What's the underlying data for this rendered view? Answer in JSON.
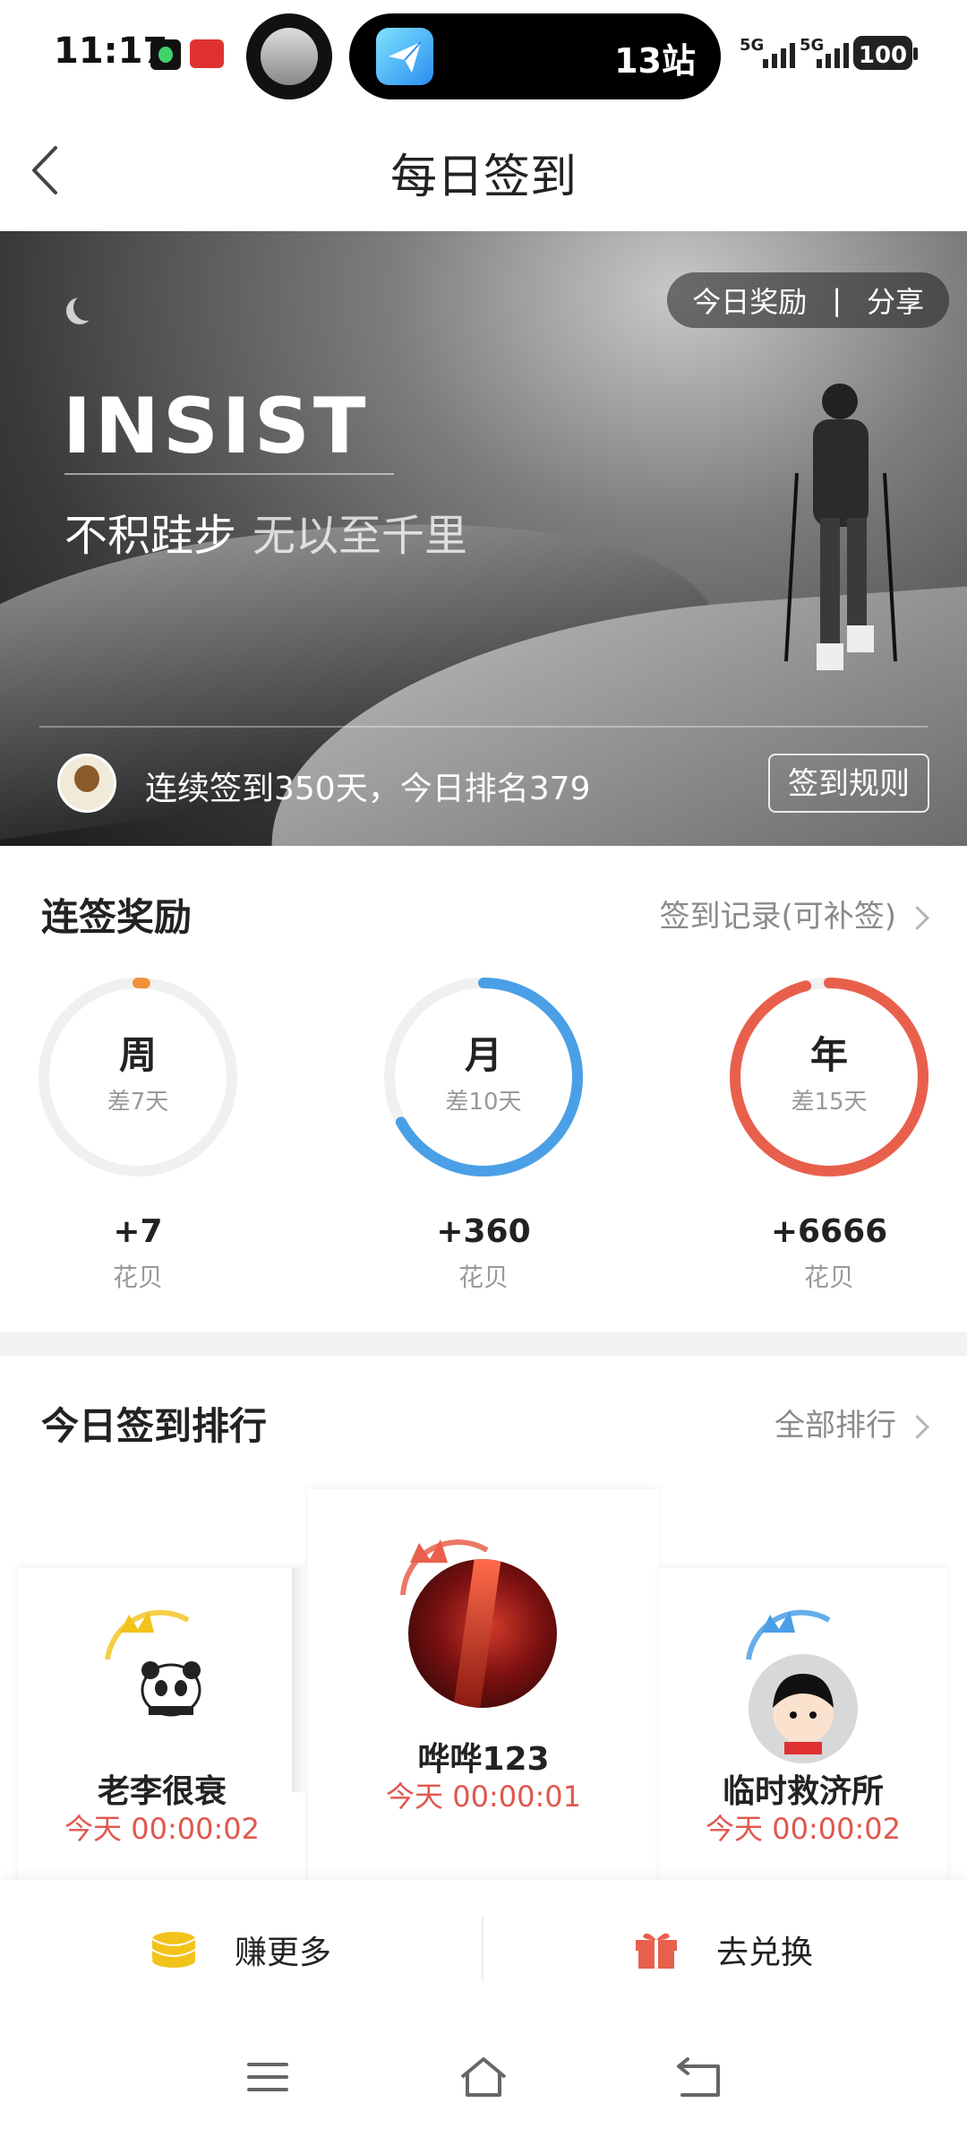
{
  "status_bar": {
    "time": "11:17",
    "island_text": "13站",
    "signal1_label": "5G",
    "signal2_label": "5G",
    "battery": "100"
  },
  "header": {
    "title": "每日签到"
  },
  "banner": {
    "tab_reward": "今日奖励",
    "tab_sep": "|",
    "tab_share": "分享",
    "headline": "INSIST",
    "motto_main": "不积跬步",
    "motto_sub": "无以至千里",
    "streak_text": "连续签到350天，今日排名379",
    "rules_button": "签到规则"
  },
  "rewards": {
    "title": "连签奖励",
    "record_link": "签到记录(可补签)",
    "items": [
      {
        "label": "周",
        "remaining": "差7天",
        "amount": "+7",
        "unit": "花贝",
        "progress": 0.0,
        "color": "#f0913a"
      },
      {
        "label": "月",
        "remaining": "差10天",
        "amount": "+360",
        "unit": "花贝",
        "progress": 0.67,
        "color": "#4a9fe6"
      },
      {
        "label": "年",
        "remaining": "差15天",
        "amount": "+6666",
        "unit": "花贝",
        "progress": 0.96,
        "color": "#e8604c"
      }
    ]
  },
  "ranking": {
    "title": "今日签到排行",
    "all_link": "全部排行",
    "entries": [
      {
        "name": "老李很衰",
        "time": "今天 00:00:02"
      },
      {
        "name": "哗哗123",
        "time": "今天 00:00:01"
      },
      {
        "name": "临时救济所",
        "time": "今天 00:00:02"
      }
    ]
  },
  "actions": {
    "earn": "赚更多",
    "exchange": "去兑换"
  },
  "colors": {
    "accent_red": "#e0574f",
    "coin_yellow": "#f2c31b",
    "gift_red": "#e8604c"
  }
}
